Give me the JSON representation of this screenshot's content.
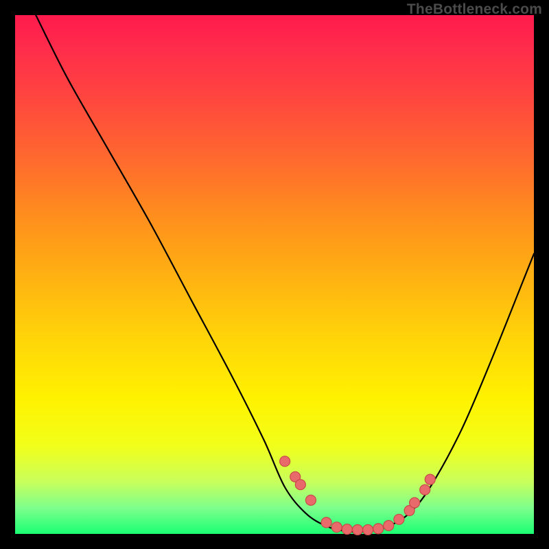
{
  "watermark": "TheBottleneck.com",
  "colors": {
    "background": "#000000",
    "gradient_top": "#ff1a4d",
    "gradient_bottom": "#1aff73",
    "curve": "#000000",
    "dot_fill": "#e96a6a",
    "dot_stroke": "#c84848"
  },
  "chart_data": {
    "type": "line",
    "title": "",
    "xlabel": "",
    "ylabel": "",
    "xlim": [
      0,
      100
    ],
    "ylim": [
      0,
      100
    ],
    "note": "No axis ticks or numeric labels are rendered in the image; x and y here are normalized 0–100 positions within the plot area, estimated from pixel geometry. The curve is an asymmetric V with a flat bottom region; dots sit along the lower portion of the curve.",
    "series": [
      {
        "name": "curve",
        "x": [
          4,
          10,
          18,
          26,
          34,
          42,
          48,
          52,
          56,
          60,
          64,
          68,
          72,
          76,
          80,
          86,
          92,
          98,
          100
        ],
        "y": [
          100,
          88,
          74,
          60,
          45,
          30,
          18,
          9,
          4,
          1.5,
          0.5,
          0.5,
          1.5,
          4,
          9,
          20,
          34,
          49,
          54
        ]
      },
      {
        "name": "dots",
        "x": [
          52,
          54,
          55,
          57,
          60,
          62,
          64,
          66,
          68,
          70,
          72,
          74,
          76,
          77,
          79,
          80
        ],
        "y": [
          14,
          11,
          9.5,
          6.5,
          2.2,
          1.3,
          0.9,
          0.8,
          0.8,
          1.0,
          1.6,
          2.8,
          4.5,
          6.0,
          8.5,
          10.5
        ]
      }
    ]
  }
}
